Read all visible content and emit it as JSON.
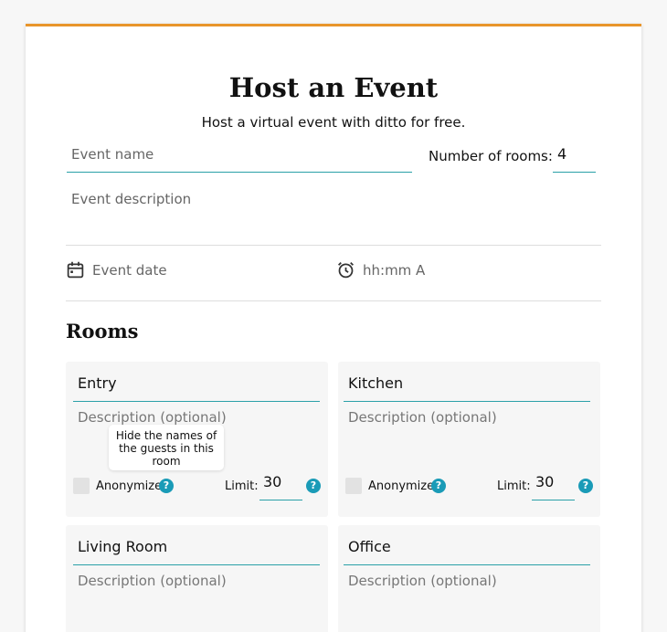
{
  "header": {
    "title": "Host an Event",
    "subtitle": "Host a virtual event with ditto for free."
  },
  "form": {
    "event_name_placeholder": "Event name",
    "rooms_label": "Number of rooms:",
    "rooms_value": "4",
    "event_description_placeholder": "Event description",
    "event_date_placeholder": "Event date",
    "event_time_placeholder": "hh:mm A"
  },
  "rooms_section": {
    "heading": "Rooms",
    "tooltip": "Hide the names of the guests in this room",
    "rooms": [
      {
        "name": "Entry",
        "description_placeholder": "Description (optional)",
        "anonymize_label": "Anonymize",
        "limit_label": "Limit:",
        "limit": "30"
      },
      {
        "name": "Kitchen",
        "description_placeholder": "Description (optional)",
        "anonymize_label": "Anonymize",
        "limit_label": "Limit:",
        "limit": "30"
      },
      {
        "name": "Living Room",
        "description_placeholder": "Description (optional)"
      },
      {
        "name": "Office",
        "description_placeholder": "Description (optional)"
      }
    ]
  },
  "colors": {
    "accent_top_border": "#e8952b",
    "input_underline": "#2aa0a8",
    "help_icon": "#1a9bb7"
  }
}
